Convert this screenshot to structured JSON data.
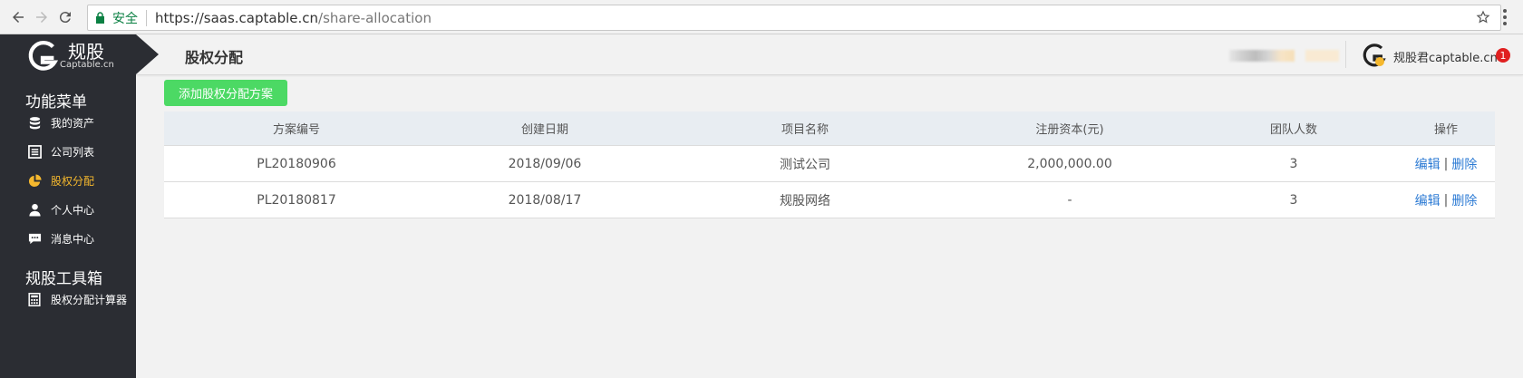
{
  "browser": {
    "secure_label": "安全",
    "url_host": "https://saas.captable.cn",
    "url_path": "/share-allocation"
  },
  "logo": {
    "cn": "规股",
    "en": "Captable.cn"
  },
  "header": {
    "page_title": "股权分配",
    "user_name": "规股君captable.cn",
    "notification_count": "1"
  },
  "sidebar": {
    "group1_title": "功能菜单",
    "items": [
      {
        "label": "我的资产",
        "icon": "database-icon",
        "active": false
      },
      {
        "label": "公司列表",
        "icon": "list-icon",
        "active": false
      },
      {
        "label": "股权分配",
        "icon": "pie-chart-icon",
        "active": true
      },
      {
        "label": "个人中心",
        "icon": "user-icon",
        "active": false
      },
      {
        "label": "消息中心",
        "icon": "message-icon",
        "active": false
      }
    ],
    "group2_title": "规股工具箱",
    "tools": [
      {
        "label": "股权分配计算器",
        "icon": "calculator-icon"
      }
    ]
  },
  "main": {
    "add_button_label": "添加股权分配方案",
    "table": {
      "headers": [
        "方案编号",
        "创建日期",
        "项目名称",
        "注册资本(元)",
        "团队人数",
        "操作"
      ],
      "rows": [
        {
          "id": "PL20180906",
          "date": "2018/09/06",
          "project": "测试公司",
          "capital": "2,000,000.00",
          "team": "3",
          "edit": "编辑",
          "sep": "|",
          "delete": "删除"
        },
        {
          "id": "PL20180817",
          "date": "2018/08/17",
          "project": "规股网络",
          "capital": "-",
          "team": "3",
          "edit": "编辑",
          "sep": "|",
          "delete": "删除"
        }
      ]
    }
  },
  "colors": {
    "sidebar_bg": "#2b2d33",
    "active_menu": "#f5b82e",
    "add_button": "#4cd964",
    "link": "#2d7bd4",
    "badge": "#e02020"
  }
}
